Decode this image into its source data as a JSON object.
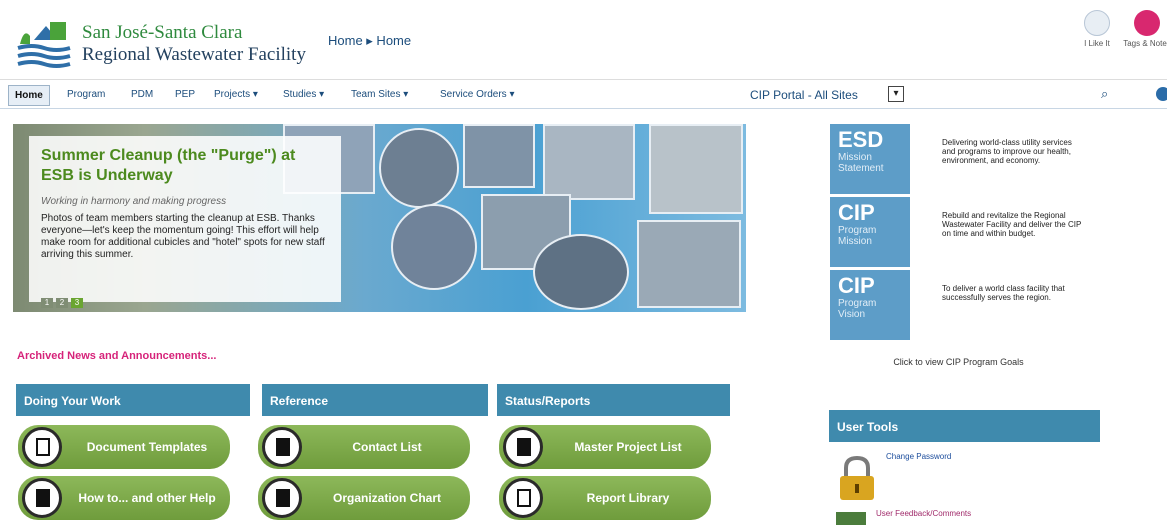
{
  "header": {
    "org_line1": "San José-Santa Clara",
    "org_line2": "Regional Wastewater Facility",
    "breadcrumb": "Home ▸ Home",
    "tools": [
      {
        "label": "I Like It",
        "icon": "thumbs-up-icon"
      },
      {
        "label": "Tags & Notes",
        "icon": "tag-icon"
      }
    ]
  },
  "nav": {
    "items": [
      "Home",
      "Program",
      "PDM",
      "PEP",
      "Projects ▾",
      "Studies ▾",
      "Team Sites ▾",
      "Service Orders ▾"
    ],
    "portal_label": "CIP Portal - All Sites",
    "portal_select": "▾"
  },
  "banner": {
    "title": "Summer Cleanup (the \"Purge\") at ESB is Underway",
    "subtitle": "Working in harmony and making progress",
    "body": "Photos of team members starting the cleanup at ESB. Thanks everyone—let's keep the momentum going! This effort will help make room for additional cubicles and \"hotel\" spots for new staff arriving this summer.",
    "pages": [
      "1",
      "2",
      "3"
    ]
  },
  "mission": [
    {
      "big": "ESD",
      "small": "Mission Statement",
      "text": "Delivering world-class utility services and programs to improve our health, environment, and economy."
    },
    {
      "big": "CIP",
      "small": "Program Mission",
      "text": "Rebuild and revitalize the Regional Wastewater Facility and deliver the CIP on time and within budget."
    },
    {
      "big": "CIP",
      "small": "Program Vision",
      "text": "To deliver a world class facility that successfully serves the region."
    }
  ],
  "goals_link": "Click to view CIP Program Goals",
  "archived": "Archived News and Announcements...",
  "columns": [
    {
      "title": "Doing Your Work",
      "buttons": [
        "Document Templates",
        "How to... and other Help"
      ]
    },
    {
      "title": "Reference",
      "buttons": [
        "Contact List",
        "Organization Chart"
      ]
    },
    {
      "title": "Status/Reports",
      "buttons": [
        "Master Project List",
        "Report Library"
      ]
    }
  ],
  "user_tools": {
    "title": "User Tools",
    "change_password": "Change Password",
    "feedback": "User Feedback/Comments"
  },
  "colors": {
    "accent": "#3f8aad",
    "button_green": "#7eab4a",
    "link": "#1c4d7c",
    "archived_pink": "#d6237a"
  }
}
